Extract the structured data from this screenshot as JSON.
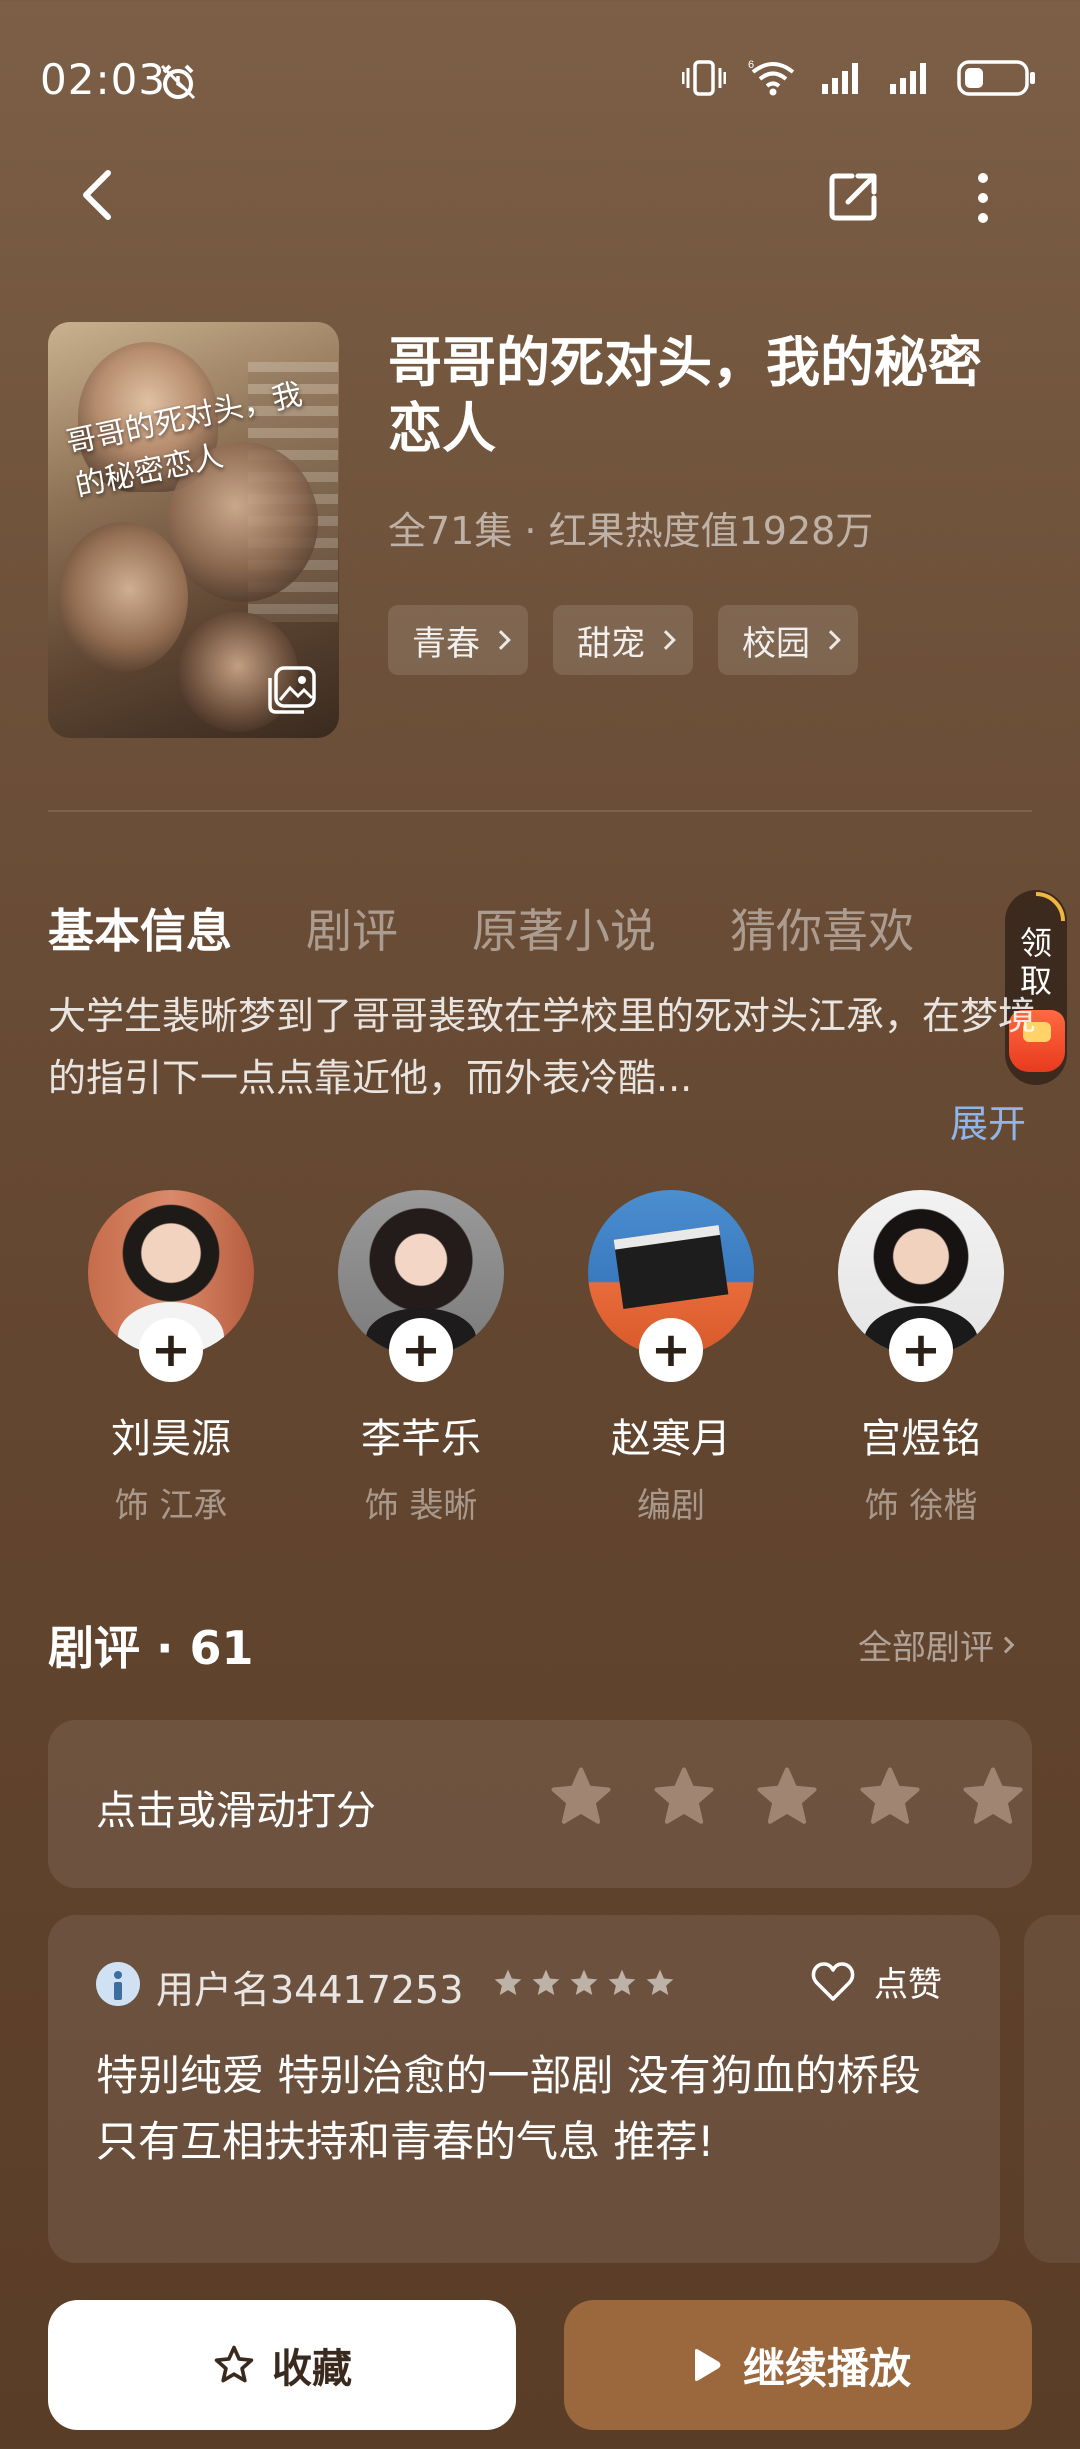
{
  "status_bar": {
    "time": "02:03",
    "icons": [
      "alarm-icon",
      "vibrate-icon",
      "wifi-icon",
      "signal-icon",
      "signal-icon",
      "battery-icon"
    ]
  },
  "top_bar": {
    "icons": [
      "back-icon",
      "share-icon",
      "more-icon"
    ]
  },
  "show": {
    "poster_title": "哥哥的死对头，我的秘密恋人",
    "title": "哥哥的死对头，我的秘密恋人",
    "meta": "全71集 · 红果热度值1928万",
    "tags": [
      {
        "label": "青春"
      },
      {
        "label": "甜宠"
      },
      {
        "label": "校园"
      }
    ]
  },
  "tabs": [
    {
      "label": "基本信息",
      "active": true
    },
    {
      "label": "剧评",
      "active": false
    },
    {
      "label": "原著小说",
      "active": false
    },
    {
      "label": "猜你喜欢",
      "active": false
    }
  ],
  "coupon": {
    "label": "领取"
  },
  "synopsis": {
    "text": "大学生裴晰梦到了哥哥裴致在学校里的死对头江承，在梦境的指引下一点点靠近他，而外表冷酷...",
    "expand_label": "展开"
  },
  "cast": [
    {
      "name": "刘昊源",
      "role": "饰 江承"
    },
    {
      "name": "李芊乐",
      "role": "饰 裴晰"
    },
    {
      "name": "赵寒月",
      "role": "编剧"
    },
    {
      "name": "宫煜铭",
      "role": "饰 徐楷"
    }
  ],
  "reviews": {
    "title": "剧评 · 61",
    "all_label": "全部剧评",
    "rate_prompt": "点击或滑动打分",
    "rating_max": 5,
    "items": [
      {
        "user": "用户名34417253",
        "stars": 5,
        "like_label": "点赞",
        "text": "特别纯爱 特别治愈的一部剧 没有狗血的桥段 只有互相扶持和青春的气息 推荐!"
      }
    ]
  },
  "actions": {
    "favorite_label": "收藏",
    "play_label": "继续播放"
  },
  "colors": {
    "background": "#6d5039",
    "play_button": "#9b673d",
    "expand_link": "#8fb6ea",
    "coupon_red": "#e83a1f"
  }
}
